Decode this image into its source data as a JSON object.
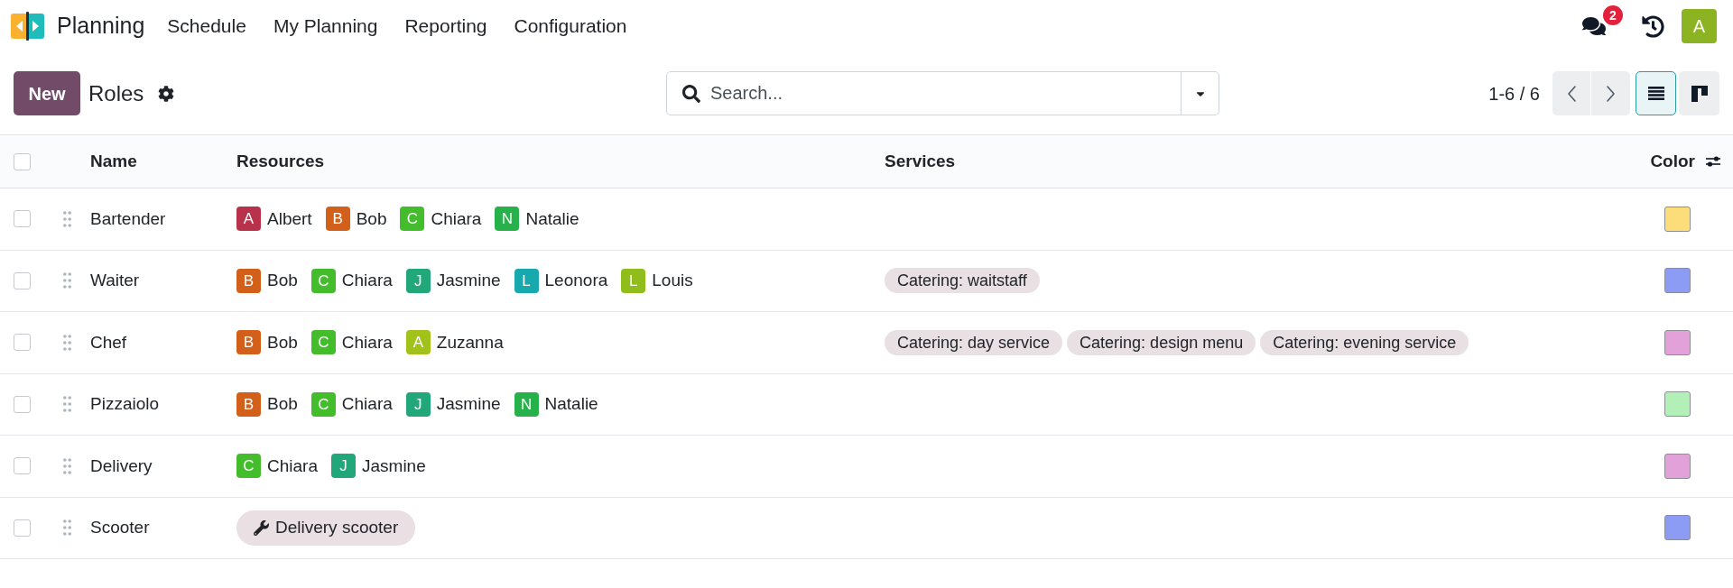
{
  "navbar": {
    "app_name": "Planning",
    "menu": [
      "Schedule",
      "My Planning",
      "Reporting",
      "Configuration"
    ],
    "unread_messages": "2",
    "user_initial": "A"
  },
  "control_panel": {
    "new_button": "New",
    "title": "Roles",
    "search": {
      "placeholder": "Search..."
    },
    "pager": "1-6 / 6",
    "views": [
      {
        "kind": "list",
        "selected": true
      },
      {
        "kind": "kanban",
        "selected": false
      }
    ]
  },
  "table": {
    "select_all": {
      "checked": false
    },
    "columns": [
      "Name",
      "Resources",
      "Services",
      "Color"
    ],
    "rows": [
      {
        "checked": false,
        "name": "Bartender",
        "resources": [
          {
            "kind": "person",
            "initial": "A",
            "name": "Albert",
            "color": "#b8324b"
          },
          {
            "kind": "person",
            "initial": "B",
            "name": "Bob",
            "color": "#d2601a"
          },
          {
            "kind": "person",
            "initial": "C",
            "name": "Chiara",
            "color": "#44bd2c"
          },
          {
            "kind": "person",
            "initial": "N",
            "name": "Natalie",
            "color": "#27b14a"
          }
        ],
        "color": "#fddc7a"
      },
      {
        "checked": false,
        "name": "Waiter",
        "resources": [
          {
            "kind": "person",
            "initial": "B",
            "name": "Bob",
            "color": "#d2601a"
          },
          {
            "kind": "person",
            "initial": "C",
            "name": "Chiara",
            "color": "#44bd2c"
          },
          {
            "kind": "person",
            "initial": "J",
            "name": "Jasmine",
            "color": "#22a77a"
          },
          {
            "kind": "person",
            "initial": "L",
            "name": "Leonora",
            "color": "#18a9ad"
          },
          {
            "kind": "person",
            "initial": "L",
            "name": "Louis",
            "color": "#90bd1c"
          }
        ],
        "services": [
          "Catering: waitstaff"
        ],
        "color": "#8c9cf5"
      },
      {
        "checked": false,
        "name": "Chef",
        "resources": [
          {
            "kind": "person",
            "initial": "B",
            "name": "Bob",
            "color": "#d2601a"
          },
          {
            "kind": "person",
            "initial": "C",
            "name": "Chiara",
            "color": "#44bd2c"
          },
          {
            "kind": "person",
            "initial": "A",
            "name": "Zuzanna",
            "color": "#a1c21b"
          }
        ],
        "services": [
          "Catering: day service",
          "Catering: design menu",
          "Catering: evening service"
        ],
        "color": "#e3a1da"
      },
      {
        "checked": false,
        "name": "Pizzaiolo",
        "resources": [
          {
            "kind": "person",
            "initial": "B",
            "name": "Bob",
            "color": "#d2601a"
          },
          {
            "kind": "person",
            "initial": "C",
            "name": "Chiara",
            "color": "#44bd2c"
          },
          {
            "kind": "person",
            "initial": "J",
            "name": "Jasmine",
            "color": "#22a77a"
          },
          {
            "kind": "person",
            "initial": "N",
            "name": "Natalie",
            "color": "#27b14a"
          }
        ],
        "color": "#b2f0b8"
      },
      {
        "checked": false,
        "name": "Delivery",
        "resources": [
          {
            "kind": "person",
            "initial": "C",
            "name": "Chiara",
            "color": "#44bd2c"
          },
          {
            "kind": "person",
            "initial": "J",
            "name": "Jasmine",
            "color": "#22a77a"
          }
        ],
        "color": "#e3a1da"
      },
      {
        "checked": false,
        "name": "Scooter",
        "resources": [
          {
            "kind": "equipment",
            "name": "Delivery scooter"
          }
        ],
        "color": "#8c9cf5"
      }
    ]
  }
}
